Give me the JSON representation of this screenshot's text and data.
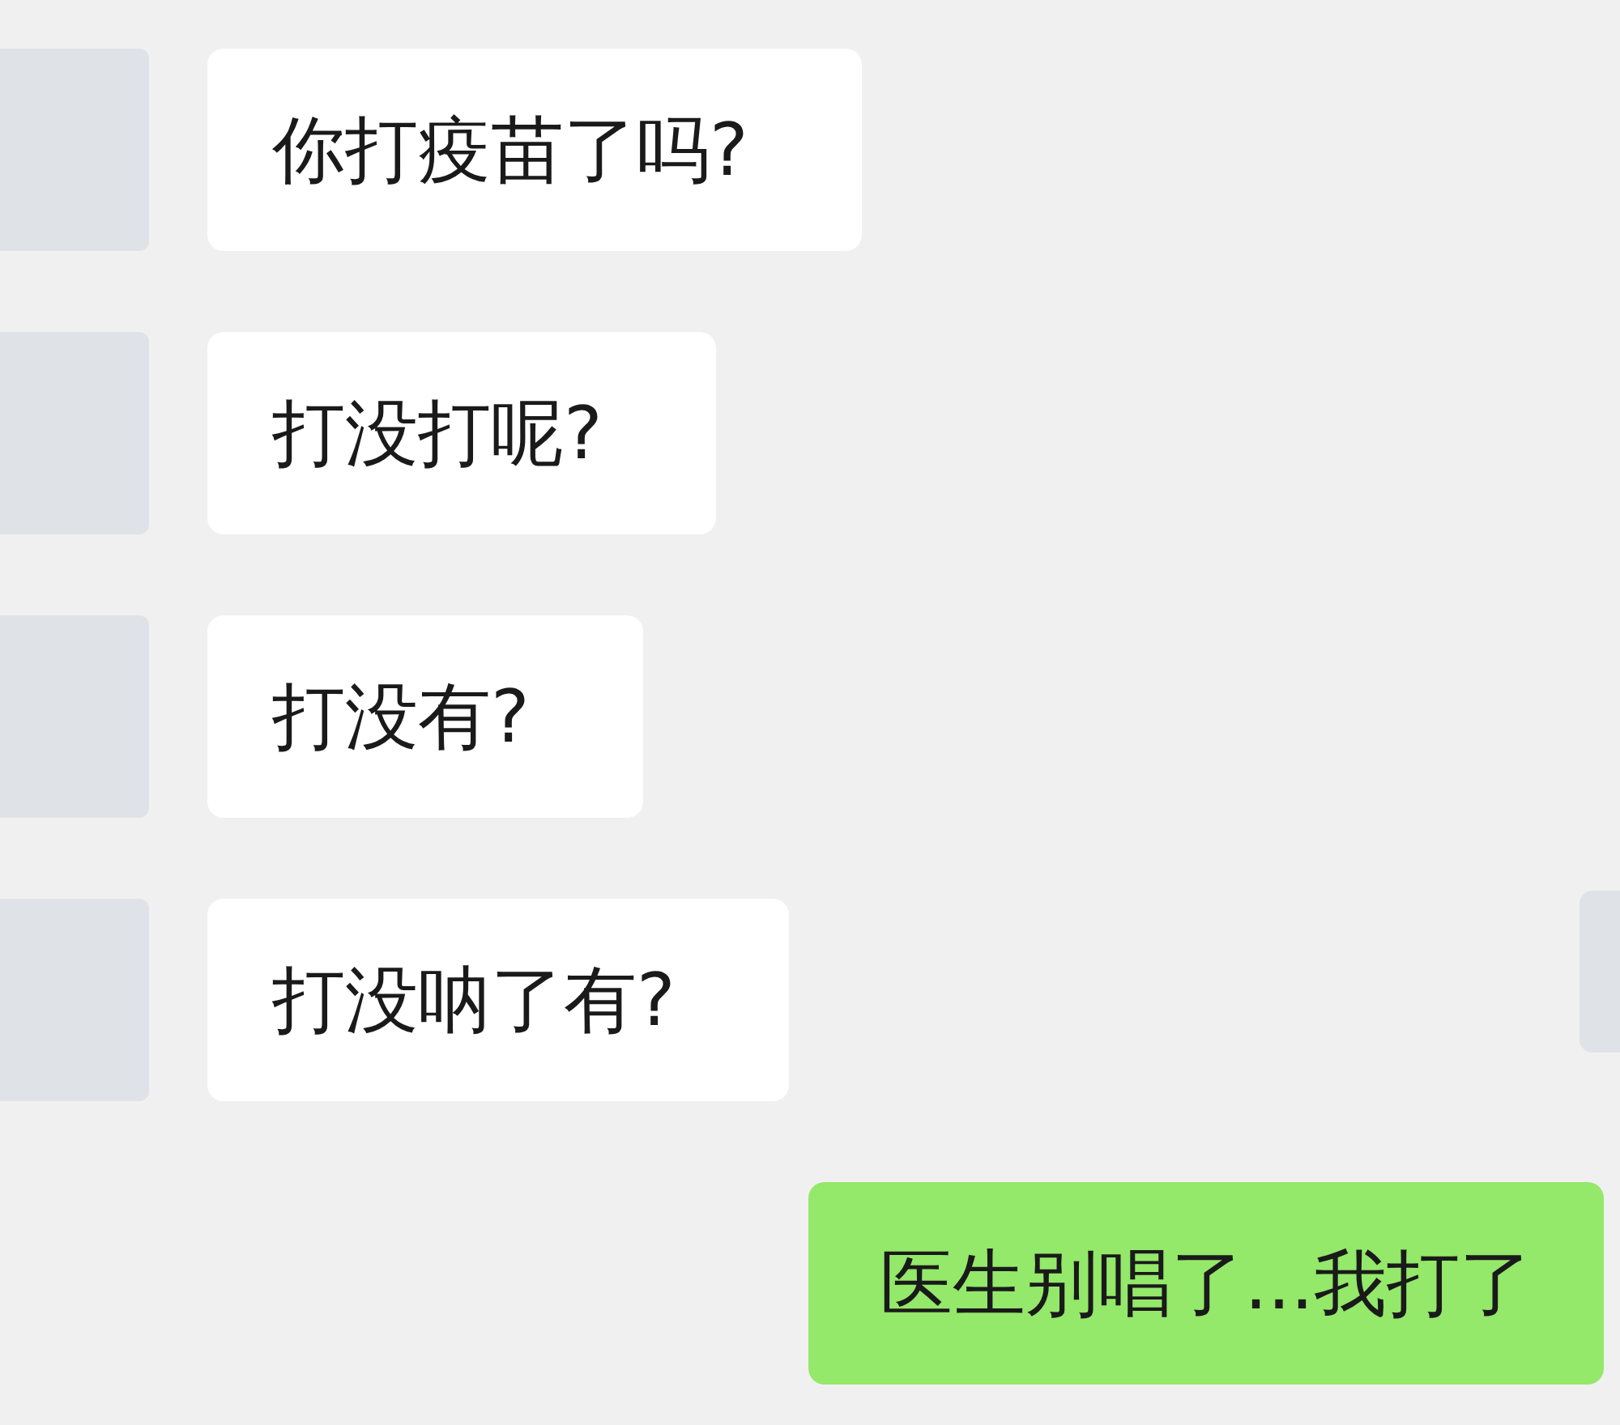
{
  "messages": [
    {
      "kind": "incoming",
      "text": "你打疫苗了吗?"
    },
    {
      "kind": "incoming",
      "text": "打没打呢?"
    },
    {
      "kind": "incoming",
      "text": "打没有?"
    },
    {
      "kind": "incoming",
      "text": "打没呐了有?"
    },
    {
      "kind": "outgoing",
      "text": "医生别唱了...我打了"
    }
  ]
}
